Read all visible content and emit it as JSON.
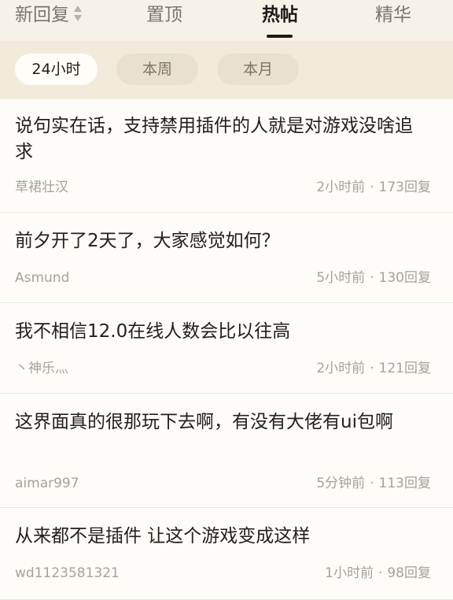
{
  "tabs": [
    {
      "label": "新回复"
    },
    {
      "label": "置顶"
    },
    {
      "label": "热帖"
    },
    {
      "label": "精华"
    }
  ],
  "active_tab": "热帖",
  "filters": [
    {
      "label": "24小时"
    },
    {
      "label": "本周"
    },
    {
      "label": "本月"
    }
  ],
  "active_filter": "24小时",
  "posts": [
    {
      "title": "说句实在话，支持禁用插件的人就是对游戏没啥追求",
      "author": "草裙壮汉",
      "time": "2小时前",
      "replies": "173回复"
    },
    {
      "title": "前夕开了2天了，大家感觉如何？",
      "author": "Asmund",
      "time": "5小时前",
      "replies": "130回复"
    },
    {
      "title": "我不相信12.0在线人数会比以往高",
      "author": "丶神乐灬",
      "time": "2小时前",
      "replies": "121回复"
    },
    {
      "title": "这界面真的很那玩下去啊，有没有大佬有ui包啊",
      "author": "aimar997",
      "time": "5分钟前",
      "replies": "113回复"
    },
    {
      "title": "从来都不是插件 让这个游戏变成这样",
      "author": "wd1123581321",
      "time": "1小时前",
      "replies": "98回复"
    }
  ],
  "separator": "·"
}
